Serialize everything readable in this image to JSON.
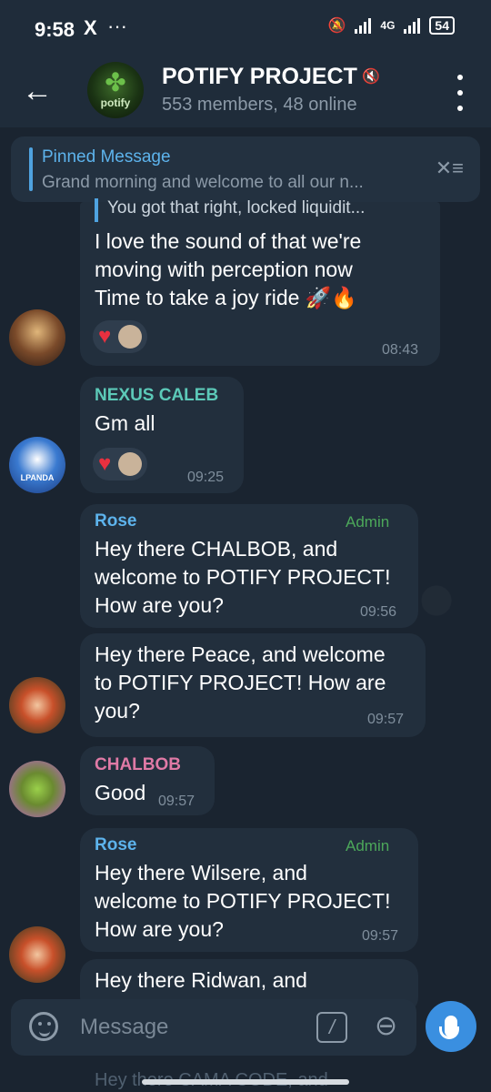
{
  "status_bar": {
    "time": "9:58",
    "x_icon": "X",
    "dots": "···",
    "network": "4G",
    "battery": "54"
  },
  "header": {
    "back_icon": "←",
    "title": "POTIFY PROJECT",
    "subtitle": "553 members, 48 online",
    "avatar_label": "potify"
  },
  "pinned": {
    "title": "Pinned Message",
    "text": "Grand morning and welcome to all our n..."
  },
  "messages": [
    {
      "quote": "You got that right, locked liquidit...",
      "lines": [
        "I love the sound of that we're",
        "moving with perception now",
        "Time to take a joy ride 🚀🔥"
      ],
      "time": "08:43"
    },
    {
      "sender": "NEXUS CALEB",
      "sender_color": "#5cc9b8",
      "text": "Gm all",
      "time": "09:25",
      "avatar_label": "LPANDA"
    },
    {
      "sender": "Rose",
      "sender_color": "#5db3ec",
      "tag": "Admin",
      "lines": [
        "Hey there CHALBOB, and",
        "welcome to POTIFY PROJECT!",
        "How are you?"
      ],
      "time": "09:56"
    },
    {
      "lines": [
        "Hey there Peace, and welcome",
        "to POTIFY PROJECT! How are",
        "you?"
      ],
      "time": "09:57"
    },
    {
      "sender": "CHALBOB",
      "sender_color": "#e07aa6",
      "text": "Good",
      "time": "09:57"
    },
    {
      "sender": "Rose",
      "sender_color": "#5db3ec",
      "tag": "Admin",
      "lines": [
        "Hey there Wilsere, and",
        "welcome to POTIFY PROJECT!",
        "How are you?"
      ],
      "time": "09:57"
    },
    {
      "lines": [
        "Hey there Ridwan, and"
      ]
    },
    {
      "lines": [
        "Hey there CAMA CODE, and"
      ]
    }
  ],
  "input": {
    "placeholder": "Message"
  },
  "colors": {
    "accent": "#3a8fe0",
    "bubble": "#222f3d",
    "background": "#1a2430",
    "admin": "#4ca85a"
  }
}
